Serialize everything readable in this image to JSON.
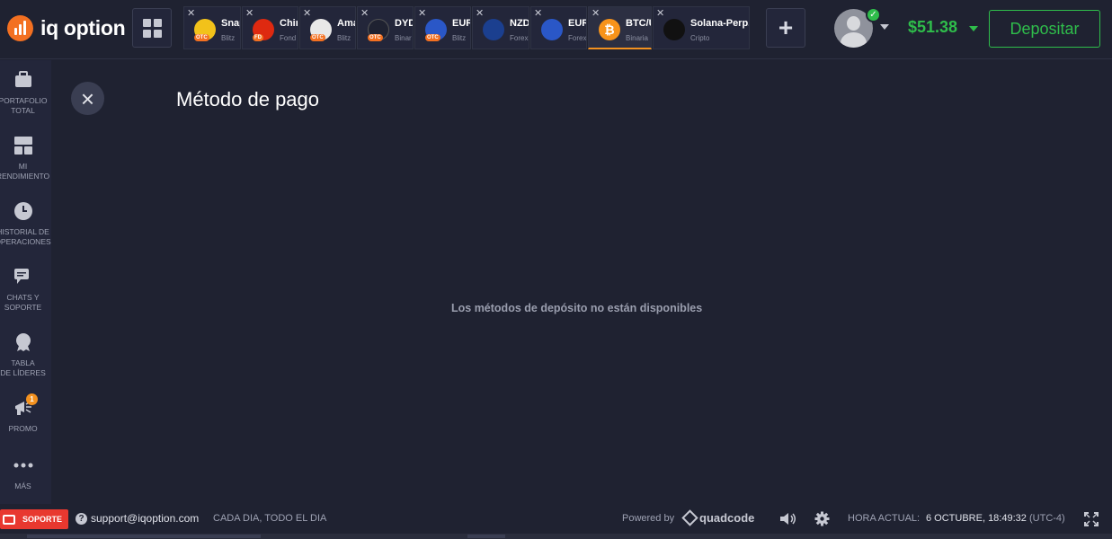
{
  "header": {
    "logo_text": "iq option",
    "tabs": [
      {
        "name": "Snap",
        "sub": "Blitz",
        "otc": "OTC",
        "color": "#f2c21a",
        "icon": "snapchat-icon"
      },
      {
        "name": "Chin",
        "sub": "Fond",
        "otc": "FD",
        "color": "#de2910",
        "icon": "china-flag-icon"
      },
      {
        "name": "Ama",
        "sub": "Blitz",
        "otc": "OTC",
        "color": "#e8e8e8",
        "icon": "amazon-icon"
      },
      {
        "name": "DYD",
        "sub": "Binar",
        "otc": "OTC",
        "color": "#1f2231",
        "icon": "dydx-icon"
      },
      {
        "name": "EUR",
        "sub": "Blitz",
        "otc": "OTC",
        "color": "#2a57c7",
        "icon": "eu-flag-icon"
      },
      {
        "name": "NZD",
        "sub": "Forex",
        "otc": "",
        "color": "#1b3f8f",
        "icon": "nz-flag-icon"
      },
      {
        "name": "EUR",
        "sub": "Forex",
        "otc": "",
        "color": "#2a57c7",
        "icon": "eu-flag-icon"
      },
      {
        "name": "BTC/U",
        "sub": "Binaria",
        "otc": "",
        "color": "#f7931a",
        "icon": "bitcoin-icon"
      },
      {
        "name": "Solana-Perp...",
        "sub": "Cripto",
        "otc": "",
        "color": "#111111",
        "icon": "solana-icon"
      }
    ],
    "add_tab_label": "+",
    "balance": "$51.38",
    "deposit_label": "Depositar"
  },
  "sidebar": {
    "items": [
      {
        "label": "PORTAFOLIO\nTOTAL",
        "icon": "briefcase-icon"
      },
      {
        "label": "MI\nRENDIMIENTO",
        "icon": "dashboard-icon"
      },
      {
        "label": "HISTORIAL DE\nOPERACIONES",
        "icon": "clock-icon"
      },
      {
        "label": "CHATS Y\nSOPORTE",
        "icon": "chat-icon"
      },
      {
        "label": "TABLA\nDE LÍDERES",
        "icon": "medal-icon"
      },
      {
        "label": "PROMO",
        "icon": "megaphone-icon",
        "badge": "1"
      },
      {
        "label": "MÁS",
        "icon": "more-icon"
      }
    ]
  },
  "main": {
    "title": "Método de pago",
    "empty_message": "Los métodos de depósito no están disponibles"
  },
  "footer": {
    "support_label": "SOPORTE",
    "email": "support@iqoption.com",
    "hours": "CADA DIA, TODO EL DIA",
    "powered_by": "Powered by",
    "brand": "quadcode",
    "time_label": "HORA ACTUAL:",
    "time_value": "6 OCTUBRE, 18:49:32",
    "timezone": "(UTC-4)"
  },
  "colors": {
    "background": "#1f2231",
    "sidebar": "#23263a",
    "accent_green": "#2fbd4b",
    "accent_orange": "#f37021",
    "support_red": "#e8382f"
  }
}
